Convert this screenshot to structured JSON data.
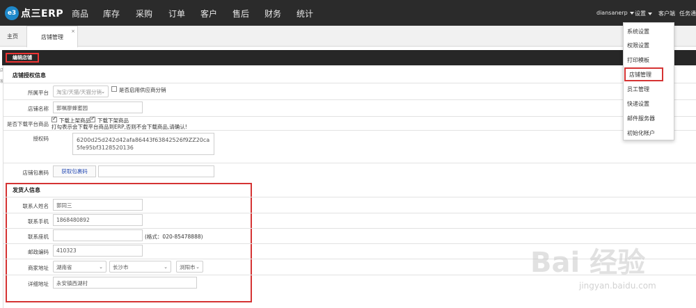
{
  "app": {
    "logo_mark": "e3",
    "logo_text": "点三ERP"
  },
  "nav": {
    "items": [
      "商品",
      "库存",
      "采购",
      "订单",
      "客户",
      "售后",
      "财务",
      "统计"
    ]
  },
  "top_right": {
    "user": "diansanerp",
    "settings": "设置",
    "client": "客户端",
    "tasks": "任务通知"
  },
  "tabs": {
    "home": "主页",
    "shop": "店铺管理",
    "close": "×"
  },
  "edit": {
    "title": "编辑店铺",
    "left_marks": [
      "店",
      "家"
    ]
  },
  "auth_section": {
    "title": "店铺授权信息",
    "platform_label": "所属平台",
    "platform_value": "淘宝/天猫/天猫分销",
    "supplier_checkbox_label": "是否启用供应商分销",
    "supplier_checked": false,
    "shop_name_label": "店铺名称",
    "shop_name_value": "郭嘱廖蜂蜜园",
    "download_label": "是否下载平台商品",
    "download_on_shelf": "下载上架商品",
    "download_on_shelf_checked": true,
    "download_off_shelf": "下载下架商品",
    "download_off_shelf_checked": true,
    "download_hint": "打勾表示会下载平台商品到ERP,否则不会下载商品,请确认!",
    "auth_code_label": "授权码",
    "auth_code_value": "6200d25d242d42afa86443f63842526f9ZZ20ca5fe95bf3128520136",
    "package_code_label": "店铺包裹码",
    "package_code_button": "获取包裹码",
    "package_code_value": ""
  },
  "sender_section": {
    "title": "发货人信息",
    "name_label": "联系人姓名",
    "name_value": "郭同三",
    "mobile_label": "联系手机",
    "mobile_value": "1868480892",
    "phone_label": "联系座机",
    "phone_value": "",
    "phone_hint": "(格式：020-85478888)",
    "zip_label": "邮政编码",
    "zip_value": "410323",
    "address_label": "商家地址",
    "province": "湖南省",
    "city": "长沙市",
    "district": "浏阳市",
    "detail_label": "详细地址",
    "detail_value": "永安镇西湖村"
  },
  "settings_menu": {
    "items": [
      "系统设置",
      "权限设置",
      "打印模板",
      "店铺管理",
      "员工管理",
      "快递设置",
      "邮件服务器",
      "初始化帐户"
    ],
    "highlighted": "店铺管理"
  },
  "watermark": {
    "main": "Bai 经验",
    "sub": "jingyan.baidu.com"
  },
  "colors": {
    "topbar": "#2b2b2b",
    "highlight_border": "#d53333",
    "link": "#2b4fb5",
    "logo": "#1e88c9"
  }
}
